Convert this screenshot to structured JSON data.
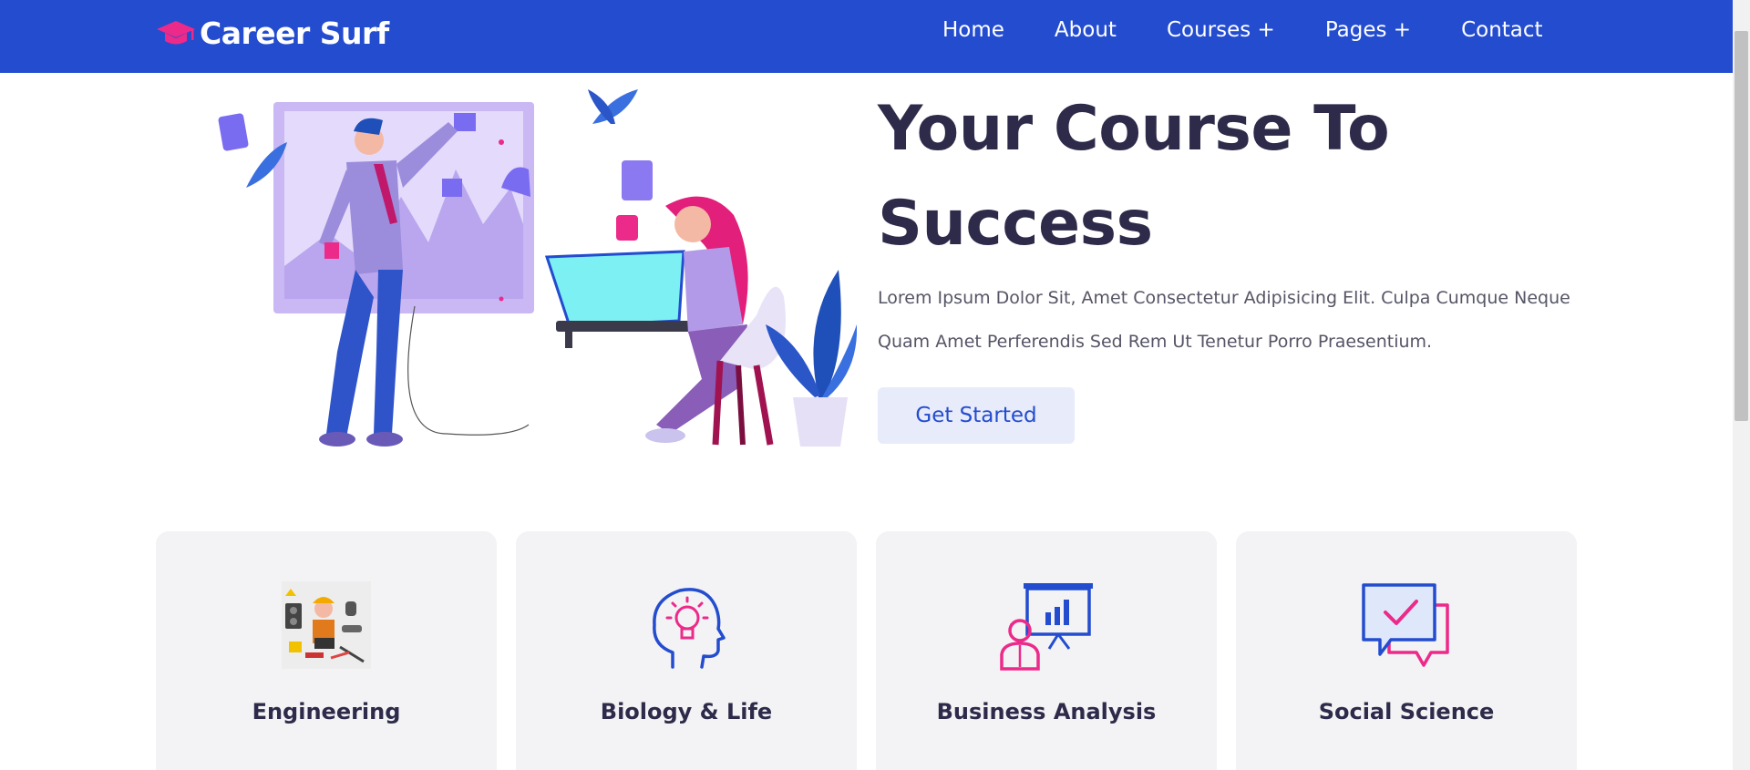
{
  "brand": {
    "name": "Career Surf",
    "icon": "graduation-cap-icon",
    "icon_color": "#ec2a8a"
  },
  "nav": {
    "items": [
      {
        "label": "Home"
      },
      {
        "label": "About"
      },
      {
        "label": "Courses +"
      },
      {
        "label": "Pages +"
      },
      {
        "label": "Contact"
      }
    ]
  },
  "hero": {
    "title": "Your Course To Success",
    "description": "Lorem Ipsum Dolor Sit, Amet Consectetur Adipisicing Elit. Culpa Cumque Neque Quam Amet Perferendis Sed Rem Ut Tenetur Porro Praesentium.",
    "button_label": "Get Started",
    "illustration": "people-working-illustration"
  },
  "categories": [
    {
      "title": "Engineering",
      "icon": "engineering-tools-icon"
    },
    {
      "title": "Biology & Life",
      "icon": "head-lightbulb-icon"
    },
    {
      "title": "Business Analysis",
      "icon": "presentation-chart-icon"
    },
    {
      "title": "Social Science",
      "icon": "chat-bubbles-check-icon"
    }
  ],
  "colors": {
    "primary": "#234ccf",
    "accent": "#ec2a8a",
    "heading": "#2d2a4a",
    "button_bg": "#e8ebfa",
    "card_bg": "#f3f3f5"
  }
}
